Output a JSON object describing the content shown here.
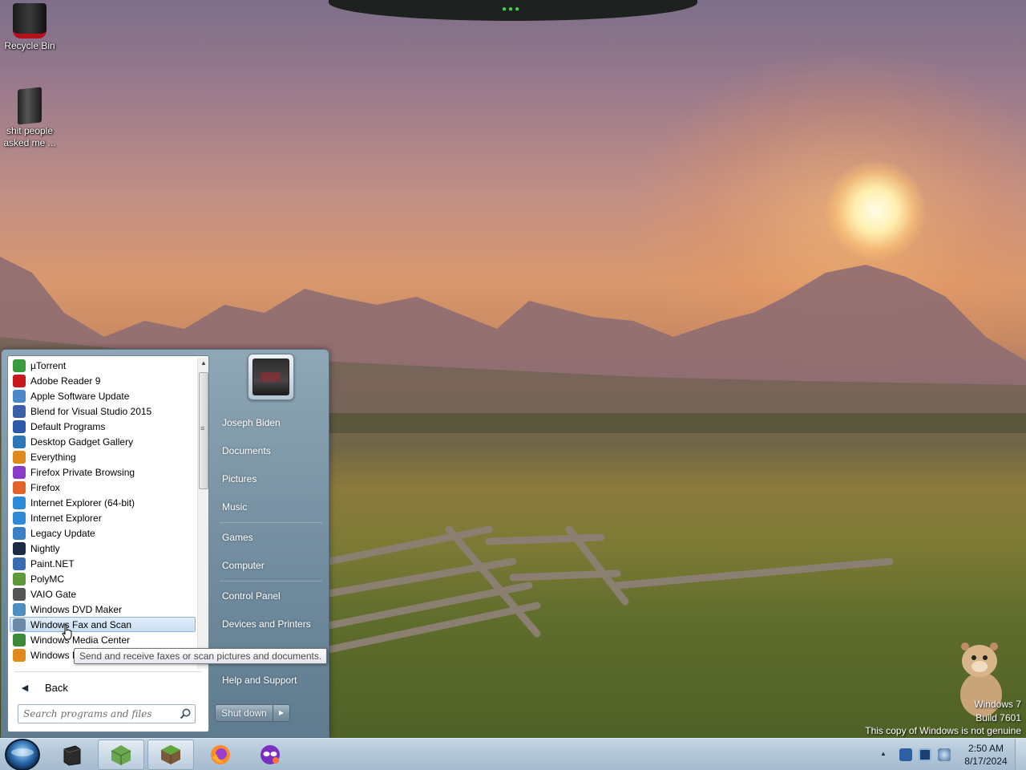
{
  "desktop": {
    "icons": [
      {
        "label": "Recycle Bin",
        "icon": "recycle-bin-icon"
      },
      {
        "label": "shit people asked me ...",
        "icon": "pc-case-icon"
      }
    ],
    "watermark": {
      "os": "Windows 7",
      "build": "Build 7601",
      "notice": "This copy of Windows is not genuine"
    }
  },
  "start_menu": {
    "programs": [
      {
        "label": "µTorrent",
        "icon": "utorrent-icon",
        "color": "#3a9b3a"
      },
      {
        "label": "Adobe Reader 9",
        "icon": "adobe-reader-icon",
        "color": "#c8171d"
      },
      {
        "label": "Apple Software Update",
        "icon": "apple-update-icon",
        "color": "#4a86c8"
      },
      {
        "label": "Blend for Visual Studio 2015",
        "icon": "blend-icon",
        "color": "#3b5fa8"
      },
      {
        "label": "Default Programs",
        "icon": "default-programs-icon",
        "color": "#2a5aa8"
      },
      {
        "label": "Desktop Gadget Gallery",
        "icon": "gadget-gallery-icon",
        "color": "#2c78b8"
      },
      {
        "label": "Everything",
        "icon": "everything-icon",
        "color": "#e08a1c"
      },
      {
        "label": "Firefox Private Browsing",
        "icon": "firefox-private-icon",
        "color": "#8a3cc8"
      },
      {
        "label": "Firefox",
        "icon": "firefox-icon",
        "color": "#e3642a"
      },
      {
        "label": "Internet Explorer (64-bit)",
        "icon": "internet-explorer-icon",
        "color": "#2d8ad8"
      },
      {
        "label": "Internet Explorer",
        "icon": "internet-explorer-icon",
        "color": "#2d8ad8"
      },
      {
        "label": "Legacy Update",
        "icon": "legacy-update-icon",
        "color": "#3b7fc4"
      },
      {
        "label": "Nightly",
        "icon": "nightly-icon",
        "color": "#1c2a44"
      },
      {
        "label": "Paint.NET",
        "icon": "paint-net-icon",
        "color": "#3a6ab0"
      },
      {
        "label": "PolyMC",
        "icon": "polymc-icon",
        "color": "#5c9a3a"
      },
      {
        "label": "VAIO Gate",
        "icon": "vaio-gate-icon",
        "color": "#555555"
      },
      {
        "label": "Windows DVD Maker",
        "icon": "dvd-maker-icon",
        "color": "#4e8fc0"
      },
      {
        "label": "Windows Fax and Scan",
        "icon": "fax-scan-icon",
        "color": "#6a8aa8",
        "selected": true
      },
      {
        "label": "Windows Media Center",
        "icon": "media-center-icon",
        "color": "#3a8a3a"
      },
      {
        "label": "Windows Media Player",
        "icon": "media-player-icon",
        "color": "#e08a1c"
      }
    ],
    "back_label": "Back",
    "search_placeholder": "Search programs and files",
    "right_items": [
      "Joseph Biden",
      "Documents",
      "Pictures",
      "Music",
      "Games",
      "Computer",
      "Control Panel",
      "Devices and Printers",
      "Help and Support"
    ],
    "shutdown_label": "Shut down",
    "tooltip": "Send and receive faxes or scan pictures and documents."
  },
  "taskbar": {
    "start_button": "start-orb-icon",
    "pinned": [
      {
        "name": "pc-case-taskbar-icon"
      },
      {
        "name": "polymc-taskbar-icon",
        "active": true
      },
      {
        "name": "minecraft-taskbar-icon",
        "active": true
      },
      {
        "name": "firefox-taskbar-icon"
      },
      {
        "name": "firefox-private-taskbar-icon"
      }
    ],
    "clock": {
      "time": "2:50 AM",
      "date": "8/17/2024"
    }
  }
}
